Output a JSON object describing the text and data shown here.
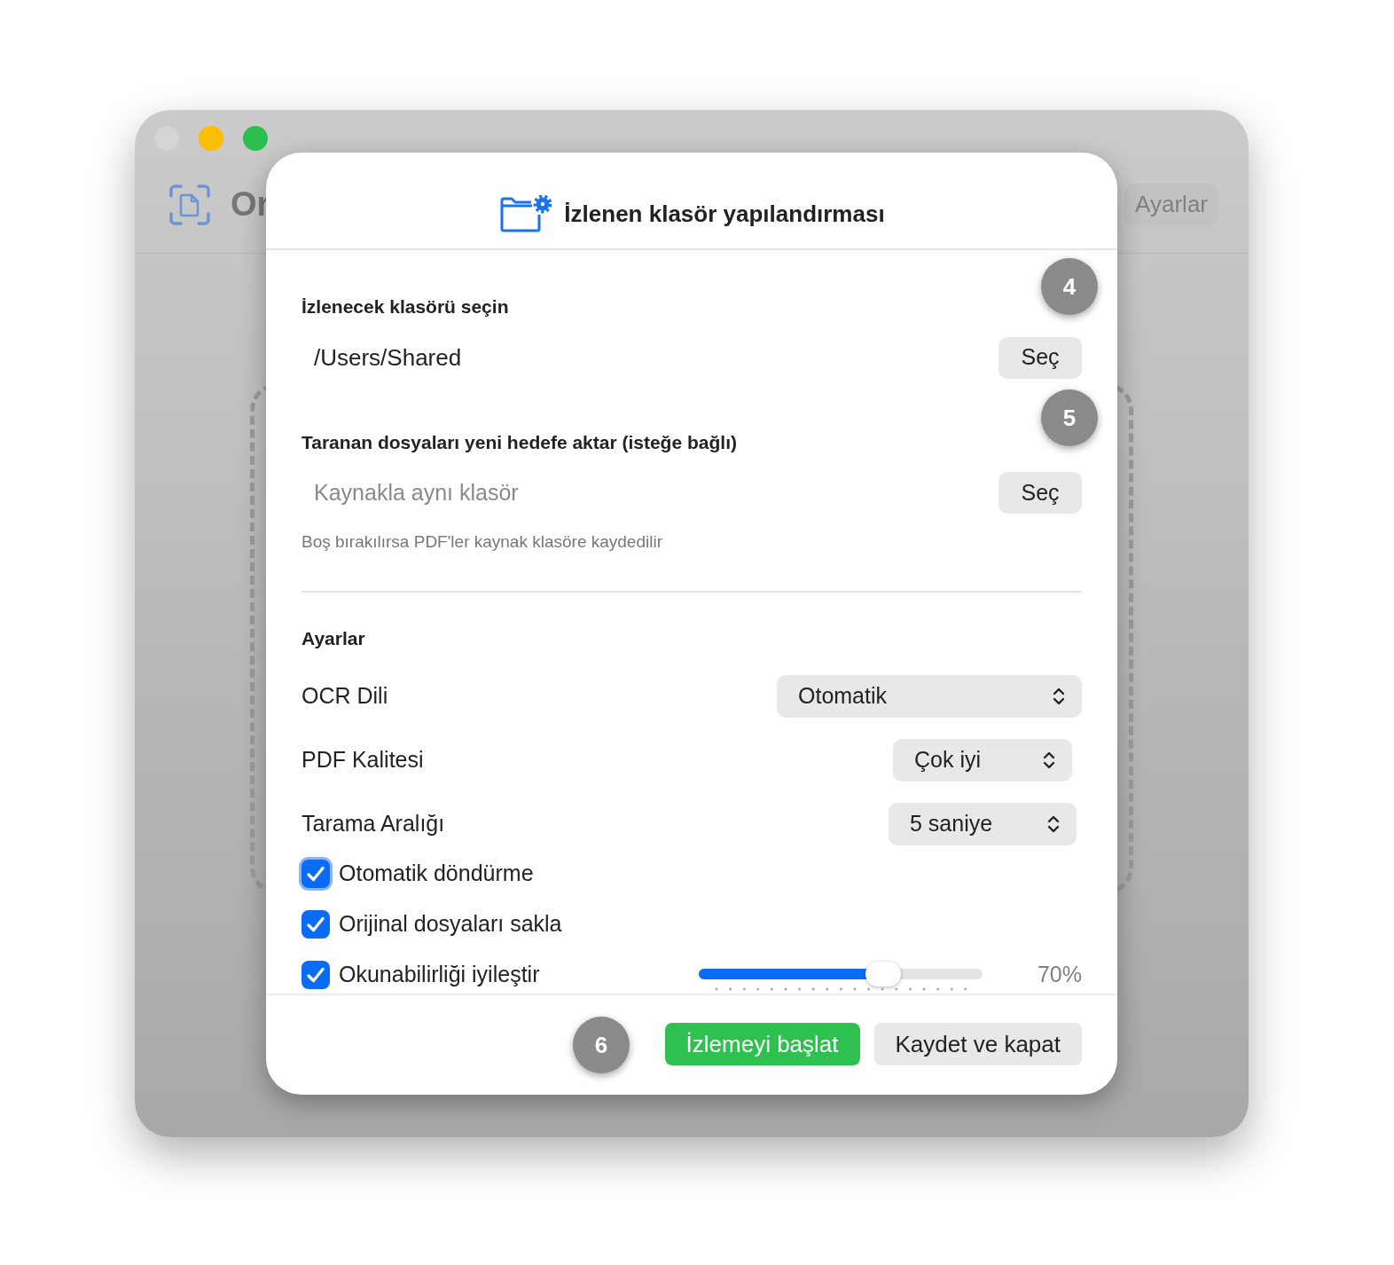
{
  "window": {
    "app_title": "Or",
    "settings_button": "Ayarlar"
  },
  "dialog": {
    "title": "İzlenen klasör yapılandırması",
    "source": {
      "label": "İzlenecek klasörü seçin",
      "value": "/Users/Shared",
      "button": "Seç",
      "step": "4"
    },
    "destination": {
      "label": "Taranan dosyaları yeni hedefe aktar **(isteğe bağlı)**",
      "placeholder": "Kaynakla aynı klasör",
      "button": "Seç",
      "hint": "Boş bırakılırsa PDF'ler kaynak klasöre kaydedilir",
      "step": "5"
    },
    "settings": {
      "heading": "Ayarlar",
      "selects": [
        {
          "label": "OCR Dili",
          "value": "Otomatik"
        },
        {
          "label": "PDF Kalitesi",
          "value": "Çok iyi"
        },
        {
          "label": "Tarama Aralığı",
          "value": "5 saniye"
        }
      ],
      "checkboxes": [
        {
          "label": "Otomatik döndürme",
          "checked": true,
          "focused": true
        },
        {
          "label": "Orijinal dosyaları sakla",
          "checked": true,
          "focused": false
        },
        {
          "label": "Okunabilirliği iyileştir",
          "checked": true,
          "focused": false,
          "slider": {
            "level": 0.65,
            "reading": "70%"
          }
        }
      ]
    },
    "footer": {
      "step": "6",
      "primary_button": "İzlemeyi başlat",
      "secondary_button": "Kaydet ve kapat"
    }
  }
}
